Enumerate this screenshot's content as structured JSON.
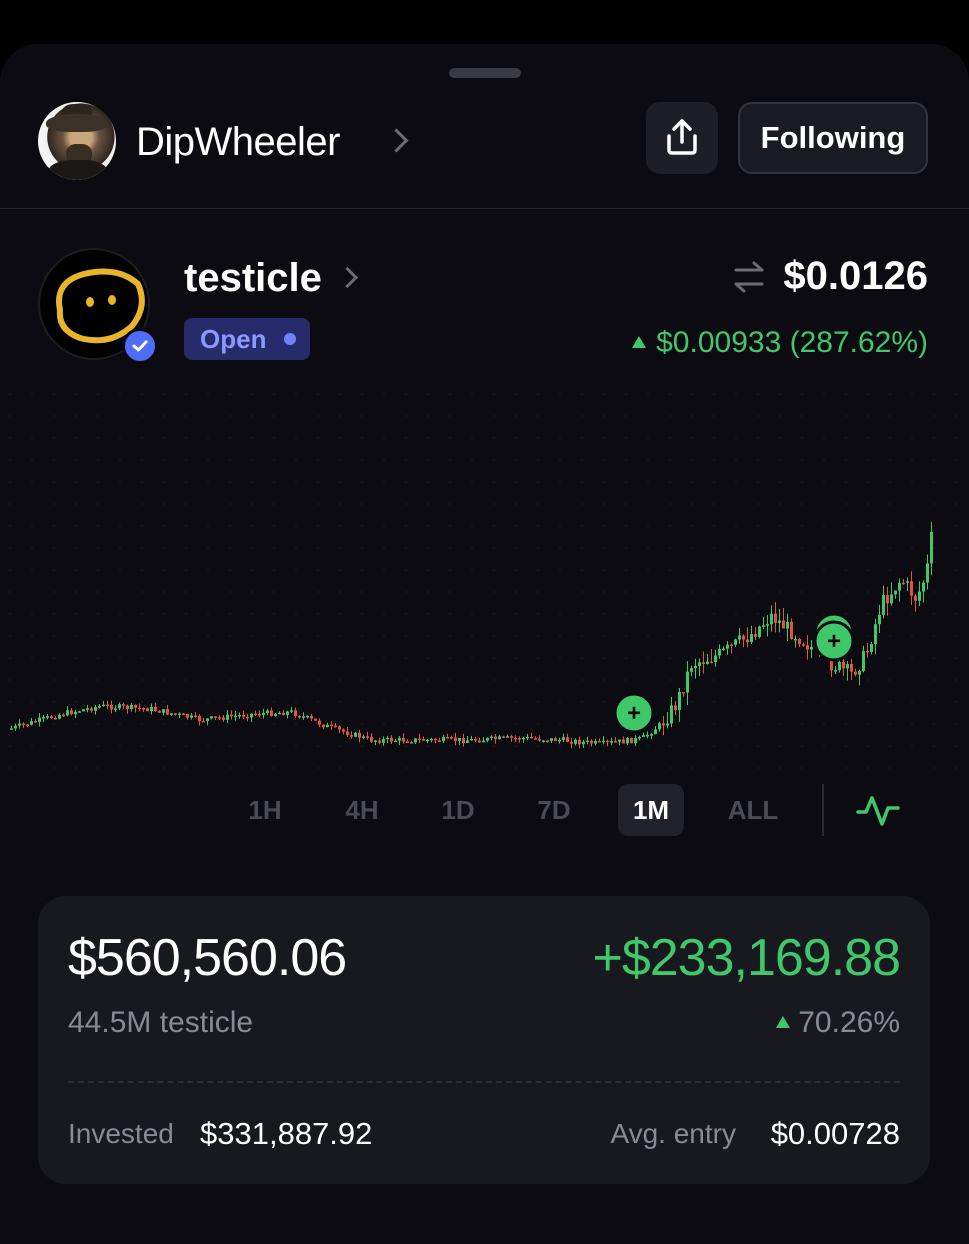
{
  "profile": {
    "username": "DipWheeler",
    "follow_label": "Following"
  },
  "token": {
    "name": "testicle",
    "status": "Open",
    "price": "$0.0126",
    "change": "$0.00933 (287.62%)"
  },
  "chart": {
    "type": "candlestick",
    "trend": "flat then sharp rise",
    "up_color": "#3fc76a",
    "down_color": "#e0553b",
    "buy_markers": 2,
    "buy_marker_label": "+"
  },
  "timeframes": {
    "items": [
      "1H",
      "4H",
      "1D",
      "7D",
      "1M",
      "ALL"
    ],
    "active": "1M"
  },
  "position": {
    "value": "$560,560.06",
    "pnl": "+$233,169.88",
    "holdings": "44.5M testicle",
    "pnl_pct": "70.26%",
    "invested_label": "Invested",
    "invested_value": "$331,887.92",
    "avg_entry_label": "Avg. entry",
    "avg_entry_value": "$0.00728"
  },
  "colors": {
    "accent_green": "#3fc76a",
    "pill_bg": "#262c6b",
    "pill_text": "#8a98ff"
  }
}
